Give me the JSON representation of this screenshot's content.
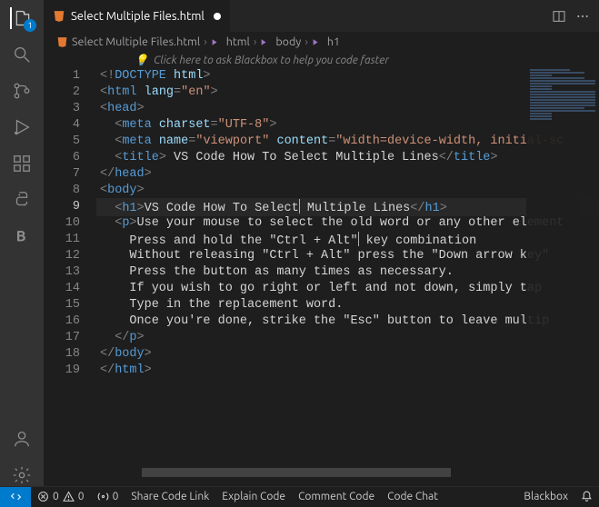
{
  "tab": {
    "filename": "Select Multiple Files.html",
    "dirty": true
  },
  "breadcrumbs": {
    "file": "Select Multiple Files.html",
    "path": [
      "html",
      "body",
      "h1"
    ]
  },
  "hint": "Click here to ask Blackbox to help you code faster",
  "activity_badge": "1",
  "editor": {
    "current_line": 9,
    "lines": [
      {
        "n": 1,
        "indent": 0,
        "tokens": [
          [
            "br",
            "<!"
          ],
          [
            "tag",
            "DOCTYPE "
          ],
          [
            "attr",
            "html"
          ],
          [
            "br",
            ">"
          ]
        ]
      },
      {
        "n": 2,
        "indent": 0,
        "tokens": [
          [
            "br",
            "<"
          ],
          [
            "tag",
            "html "
          ],
          [
            "attr",
            "lang"
          ],
          [
            "br",
            "="
          ],
          [
            "str",
            "\"en\""
          ],
          [
            "br",
            ">"
          ]
        ]
      },
      {
        "n": 3,
        "indent": 0,
        "tokens": [
          [
            "br",
            "<"
          ],
          [
            "tag",
            "head"
          ],
          [
            "br",
            ">"
          ]
        ]
      },
      {
        "n": 4,
        "indent": 1,
        "tokens": [
          [
            "br",
            "<"
          ],
          [
            "tag",
            "meta "
          ],
          [
            "attr",
            "charset"
          ],
          [
            "br",
            "="
          ],
          [
            "str",
            "\"UTF-8\""
          ],
          [
            "br",
            ">"
          ]
        ]
      },
      {
        "n": 5,
        "indent": 1,
        "tokens": [
          [
            "br",
            "<"
          ],
          [
            "tag",
            "meta "
          ],
          [
            "attr",
            "name"
          ],
          [
            "br",
            "="
          ],
          [
            "str",
            "\"viewport\" "
          ],
          [
            "attr",
            "content"
          ],
          [
            "br",
            "="
          ],
          [
            "str",
            "\"width=device-width, initial-sc"
          ]
        ]
      },
      {
        "n": 6,
        "indent": 1,
        "tokens": [
          [
            "br",
            "<"
          ],
          [
            "tag",
            "title"
          ],
          [
            "br",
            ">"
          ],
          [
            "txt",
            " VS Code How To Select Multiple Lines"
          ],
          [
            "br",
            "</"
          ],
          [
            "tag",
            "title"
          ],
          [
            "br",
            ">"
          ]
        ]
      },
      {
        "n": 7,
        "indent": 0,
        "tokens": [
          [
            "br",
            "</"
          ],
          [
            "tag",
            "head"
          ],
          [
            "br",
            ">"
          ]
        ]
      },
      {
        "n": 8,
        "indent": 0,
        "tokens": [
          [
            "br",
            "<"
          ],
          [
            "tag",
            "body"
          ],
          [
            "br",
            ">"
          ]
        ]
      },
      {
        "n": 9,
        "indent": 1,
        "tokens": [
          [
            "br",
            "<"
          ],
          [
            "tag",
            "h1"
          ],
          [
            "br",
            ">"
          ],
          [
            "txt",
            "VS Code How To Select"
          ],
          [
            "cur",
            ""
          ],
          [
            "txt",
            " Multiple Lines"
          ],
          [
            "br",
            "</"
          ],
          [
            "tag",
            "h1"
          ],
          [
            "br",
            ">"
          ]
        ]
      },
      {
        "n": 10,
        "indent": 1,
        "tokens": [
          [
            "br",
            "<"
          ],
          [
            "tag",
            "p"
          ],
          [
            "br",
            ">"
          ],
          [
            "txt",
            "Use your mouse to select the old word or any other element"
          ]
        ]
      },
      {
        "n": 11,
        "indent": 2,
        "tokens": [
          [
            "txt",
            "Press and hold the \"Ctrl + Alt\""
          ],
          [
            "cur",
            ""
          ],
          [
            "txt",
            " key combination"
          ]
        ]
      },
      {
        "n": 12,
        "indent": 2,
        "tokens": [
          [
            "txt",
            "Without releasing \"Ctrl + Alt\" press the \"Down arrow key\""
          ]
        ]
      },
      {
        "n": 13,
        "indent": 2,
        "tokens": [
          [
            "txt",
            "Press the button as many times as necessary."
          ]
        ]
      },
      {
        "n": 14,
        "indent": 2,
        "tokens": [
          [
            "txt",
            "If you wish to go right or left and not down, simply tap "
          ]
        ]
      },
      {
        "n": 15,
        "indent": 2,
        "tokens": [
          [
            "txt",
            "Type in the replacement word."
          ]
        ]
      },
      {
        "n": 16,
        "indent": 2,
        "tokens": [
          [
            "txt",
            "Once you're done, strike the \"Esc\" button to leave multip"
          ]
        ]
      },
      {
        "n": 17,
        "indent": 1,
        "tokens": [
          [
            "br",
            "</"
          ],
          [
            "tag",
            "p"
          ],
          [
            "br",
            ">"
          ]
        ]
      },
      {
        "n": 18,
        "indent": 0,
        "tokens": [
          [
            "br",
            "</"
          ],
          [
            "tag",
            "body"
          ],
          [
            "br",
            ">"
          ]
        ]
      },
      {
        "n": 19,
        "indent": 0,
        "tokens": [
          [
            "br",
            "</"
          ],
          [
            "tag",
            "html"
          ],
          [
            "br",
            ">"
          ]
        ]
      }
    ]
  },
  "status": {
    "errors": "0",
    "warnings": "0",
    "ports": "0",
    "items_center": [
      "Share Code Link",
      "Explain Code",
      "Comment Code",
      "Code Chat"
    ],
    "right": "Blackbox"
  }
}
